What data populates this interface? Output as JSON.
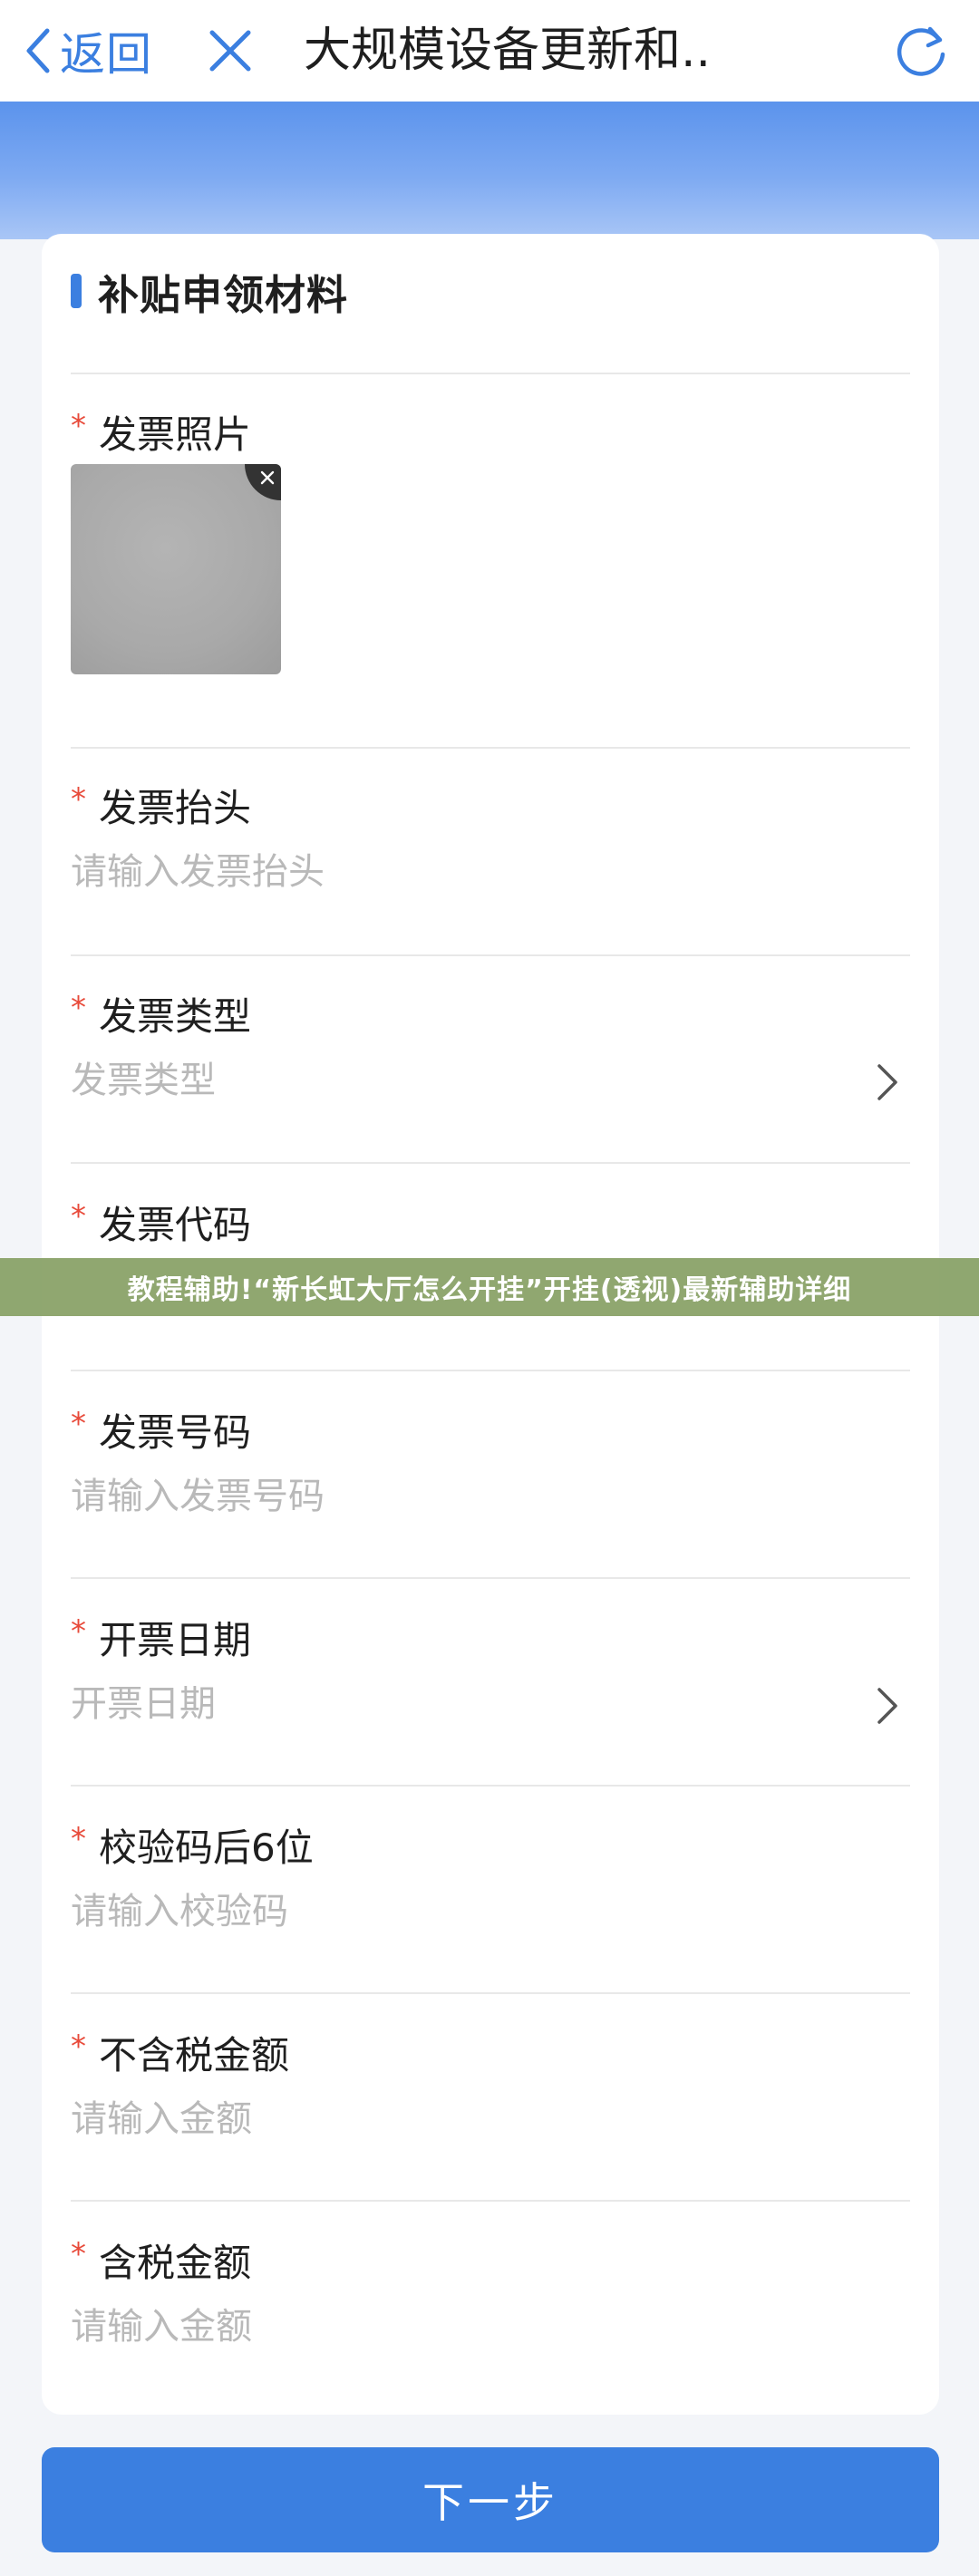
{
  "nav": {
    "back_label": "返回",
    "title": "大规模设备更新和..",
    "accent": "#3b7fe0"
  },
  "section": {
    "title": "补贴申领材料"
  },
  "required_mark": "*",
  "fields": {
    "photo": {
      "label": "发票照片"
    },
    "invoice_header": {
      "label": "发票抬头",
      "placeholder": "请输入发票抬头",
      "value": ""
    },
    "invoice_type": {
      "label": "发票类型",
      "placeholder": "发票类型"
    },
    "invoice_code": {
      "label": "发票代码",
      "placeholder": "",
      "value": ""
    },
    "invoice_number": {
      "label": "发票号码",
      "placeholder": "请输入发票号码",
      "value": ""
    },
    "issue_date": {
      "label": "开票日期",
      "placeholder": "开票日期"
    },
    "check_code": {
      "label": "校验码后6位",
      "placeholder": "请输入校验码",
      "value": ""
    },
    "amount_excl_tax": {
      "label": "不含税金额",
      "placeholder": "请输入金额",
      "value": ""
    },
    "amount_incl_tax": {
      "label": "含税金额",
      "placeholder": "请输入金额",
      "value": ""
    }
  },
  "overlay_text": "教程辅助!“新长虹大厅怎么开挂”开挂(透视)最新辅助详细",
  "next_button_label": "下一步",
  "icons": {
    "back": "chevron-left-icon",
    "close": "close-icon",
    "refresh": "refresh-icon",
    "select": "chevron-right-icon",
    "delete": "close-icon"
  }
}
